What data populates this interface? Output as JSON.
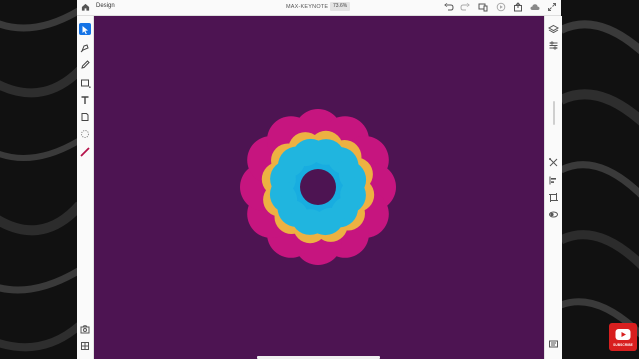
{
  "topbar": {
    "tab_label": "Design",
    "document_title": "MAX-KEYNOTE",
    "zoom_level": "73.6%"
  },
  "left_tools": [
    {
      "name": "select-tool",
      "icon": "arrow-pointer-icon",
      "active": true
    },
    {
      "name": "pen-tool",
      "icon": "pen-icon"
    },
    {
      "name": "pencil-tool",
      "icon": "pencil-icon"
    },
    {
      "name": "shape-tool",
      "icon": "rectangle-icon"
    },
    {
      "name": "text-tool",
      "icon": "text-icon"
    },
    {
      "name": "image-tool",
      "icon": "image-icon"
    },
    {
      "name": "ellipse-tool",
      "icon": "dashed-circle-icon"
    },
    {
      "name": "brush-tool",
      "icon": "brush-icon"
    }
  ],
  "right_tools": [
    "layers-icon",
    "properties-icon",
    "transform-icon",
    "align-icon",
    "crop-icon",
    "opacity-icon",
    "comments-icon"
  ],
  "colors": {
    "canvas": "#4d1452",
    "petal_pink": "#e8168c",
    "petal_yellow": "#f2c23c",
    "petal_cyan": "#16b6e8",
    "accent": "#1473e6"
  },
  "overlay": {
    "subscribe_label": "SUBSCRIBE"
  }
}
